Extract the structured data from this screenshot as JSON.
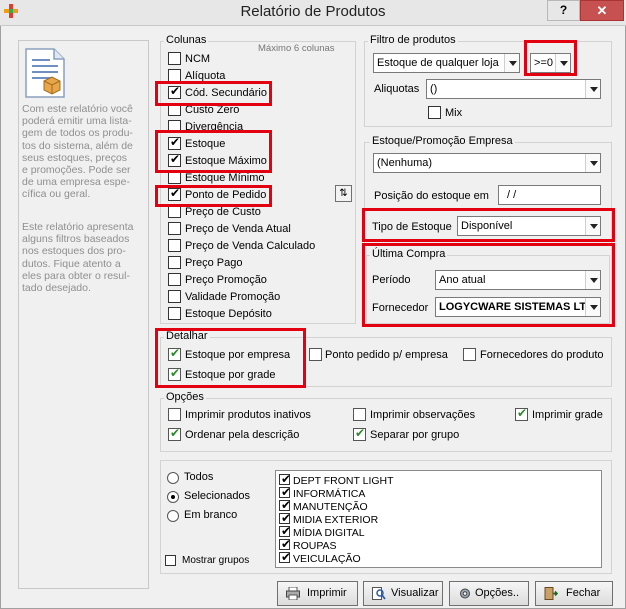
{
  "window": {
    "title": "Relatório de Produtos",
    "help_label": "?",
    "close_label": "✕"
  },
  "side_panel": {
    "para1": "Com este relatório você\npoderá  emitir uma lista-\ngem de todos os produ-\ntos do sistema, além de\nseus estoques,  preços\ne promoções.  Pode ser\nde  uma empresa espe-\ncífica ou geral.",
    "para2": "Este relatório apresenta\nalguns  filtros baseados\nnos  estoques  dos pro-\ndutos.  Fique  atento a\neles  para obter o resul-\ntado desejado."
  },
  "colunas": {
    "legend": "Colunas",
    "max_note": "Máximo 6 colunas",
    "swap_icon": "⇅",
    "items": [
      {
        "label": "NCM",
        "checked": false
      },
      {
        "label": "Alíquota",
        "checked": false
      },
      {
        "label": "Cód. Secundário",
        "checked": true
      },
      {
        "label": "Custo Zero",
        "checked": false
      },
      {
        "label": "Divergência",
        "checked": false
      },
      {
        "label": "Estoque",
        "checked": true
      },
      {
        "label": "Estoque Máximo",
        "checked": true
      },
      {
        "label": "Estoque Mínimo",
        "checked": false
      },
      {
        "label": "Ponto de Pedido",
        "checked": true
      },
      {
        "label": "Preço de Custo",
        "checked": false
      },
      {
        "label": "Preço de Venda Atual",
        "checked": false
      },
      {
        "label": "Preço de Venda Calculado",
        "checked": false
      },
      {
        "label": "Preço Pago",
        "checked": false
      },
      {
        "label": "Preço Promoção",
        "checked": false
      },
      {
        "label": "Validade Promoção",
        "checked": false
      },
      {
        "label": "Estoque Depósito",
        "checked": false
      }
    ]
  },
  "filtro": {
    "legend": "Filtro de produtos",
    "estoque_select": "Estoque de qualquer loja",
    "operator_select": ">=0",
    "aliquotas_label": "Aliquotas",
    "aliquotas_value": "()",
    "mix_label": "Mix",
    "mix_checked": false
  },
  "estoque_promo": {
    "legend": "Estoque/Promoção Empresa",
    "empresa_select": "(Nenhuma)",
    "posicao_label": "Posição do estoque em",
    "posicao_value": "/ /",
    "tipo_label": "Tipo de Estoque",
    "tipo_value": "Disponível"
  },
  "ultima_compra": {
    "legend": "Última Compra",
    "periodo_label": "Período",
    "periodo_value": "Ano atual",
    "fornecedor_label": "Fornecedor",
    "fornecedor_value": "LOGYCWARE SISTEMAS LT"
  },
  "detalhar": {
    "legend": "Detalhar",
    "items": [
      {
        "label": "Estoque por empresa",
        "checked": true
      },
      {
        "label": "Estoque por grade",
        "checked": true
      },
      {
        "label": "Ponto pedido p/ empresa",
        "checked": false
      },
      {
        "label": "Fornecedores do produto",
        "checked": false
      }
    ]
  },
  "opcoes": {
    "legend": "Opções",
    "items": [
      {
        "label": "Imprimir produtos inativos",
        "checked": false
      },
      {
        "label": "Imprimir observações",
        "checked": false
      },
      {
        "label": "Imprimir grade",
        "checked": true
      },
      {
        "label": "Ordenar pela descrição",
        "checked": true
      },
      {
        "label": "Separar por grupo",
        "checked": true
      }
    ]
  },
  "grupos": {
    "radios": [
      {
        "label": "Todos",
        "checked": false
      },
      {
        "label": "Selecionados",
        "checked": true
      },
      {
        "label": "Em branco",
        "checked": false
      }
    ],
    "mostrar_label": "Mostrar grupos",
    "mostrar_checked": false,
    "list": [
      {
        "label": "DEPT FRONT LIGHT",
        "checked": true
      },
      {
        "label": "INFORMÁTICA",
        "checked": true
      },
      {
        "label": "MANUTENÇÃO",
        "checked": true
      },
      {
        "label": "MIDIA EXTERIOR",
        "checked": true
      },
      {
        "label": "MÍDIA DIGITAL",
        "checked": true
      },
      {
        "label": "ROUPAS",
        "checked": true
      },
      {
        "label": "VEICULAÇÃO",
        "checked": true
      }
    ]
  },
  "buttons": {
    "imprimir": "Imprimir",
    "visualizar": "Visualizar",
    "opcoes": "Opções..",
    "fechar": "Fechar"
  },
  "colors": {
    "highlight": "#e30010",
    "close_button": "#c75050",
    "check_green": "#2c8a2c"
  }
}
